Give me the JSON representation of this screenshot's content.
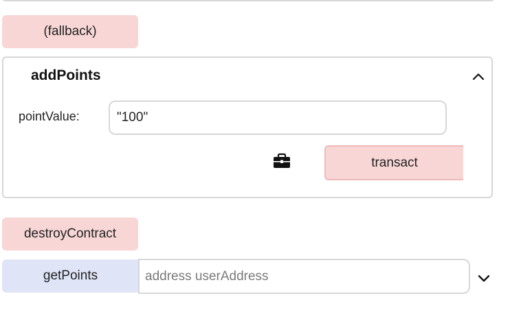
{
  "functions": {
    "fallback_label": "(fallback)",
    "add_points": {
      "title": "addPoints",
      "param_label": "pointValue:",
      "param_value": "\"100\"",
      "transact_label": "transact",
      "collapse_icon": "chevron-up-icon",
      "copy_icon": "briefcase-icon"
    },
    "destroy_label": "destroyContract",
    "get_points": {
      "label": "getPoints",
      "placeholder": "address userAddress",
      "expand_icon": "chevron-down-icon"
    }
  },
  "colors": {
    "transact_button": "#f8d6d6",
    "call_button": "#dfe5f7",
    "border": "#d7d7d7"
  }
}
